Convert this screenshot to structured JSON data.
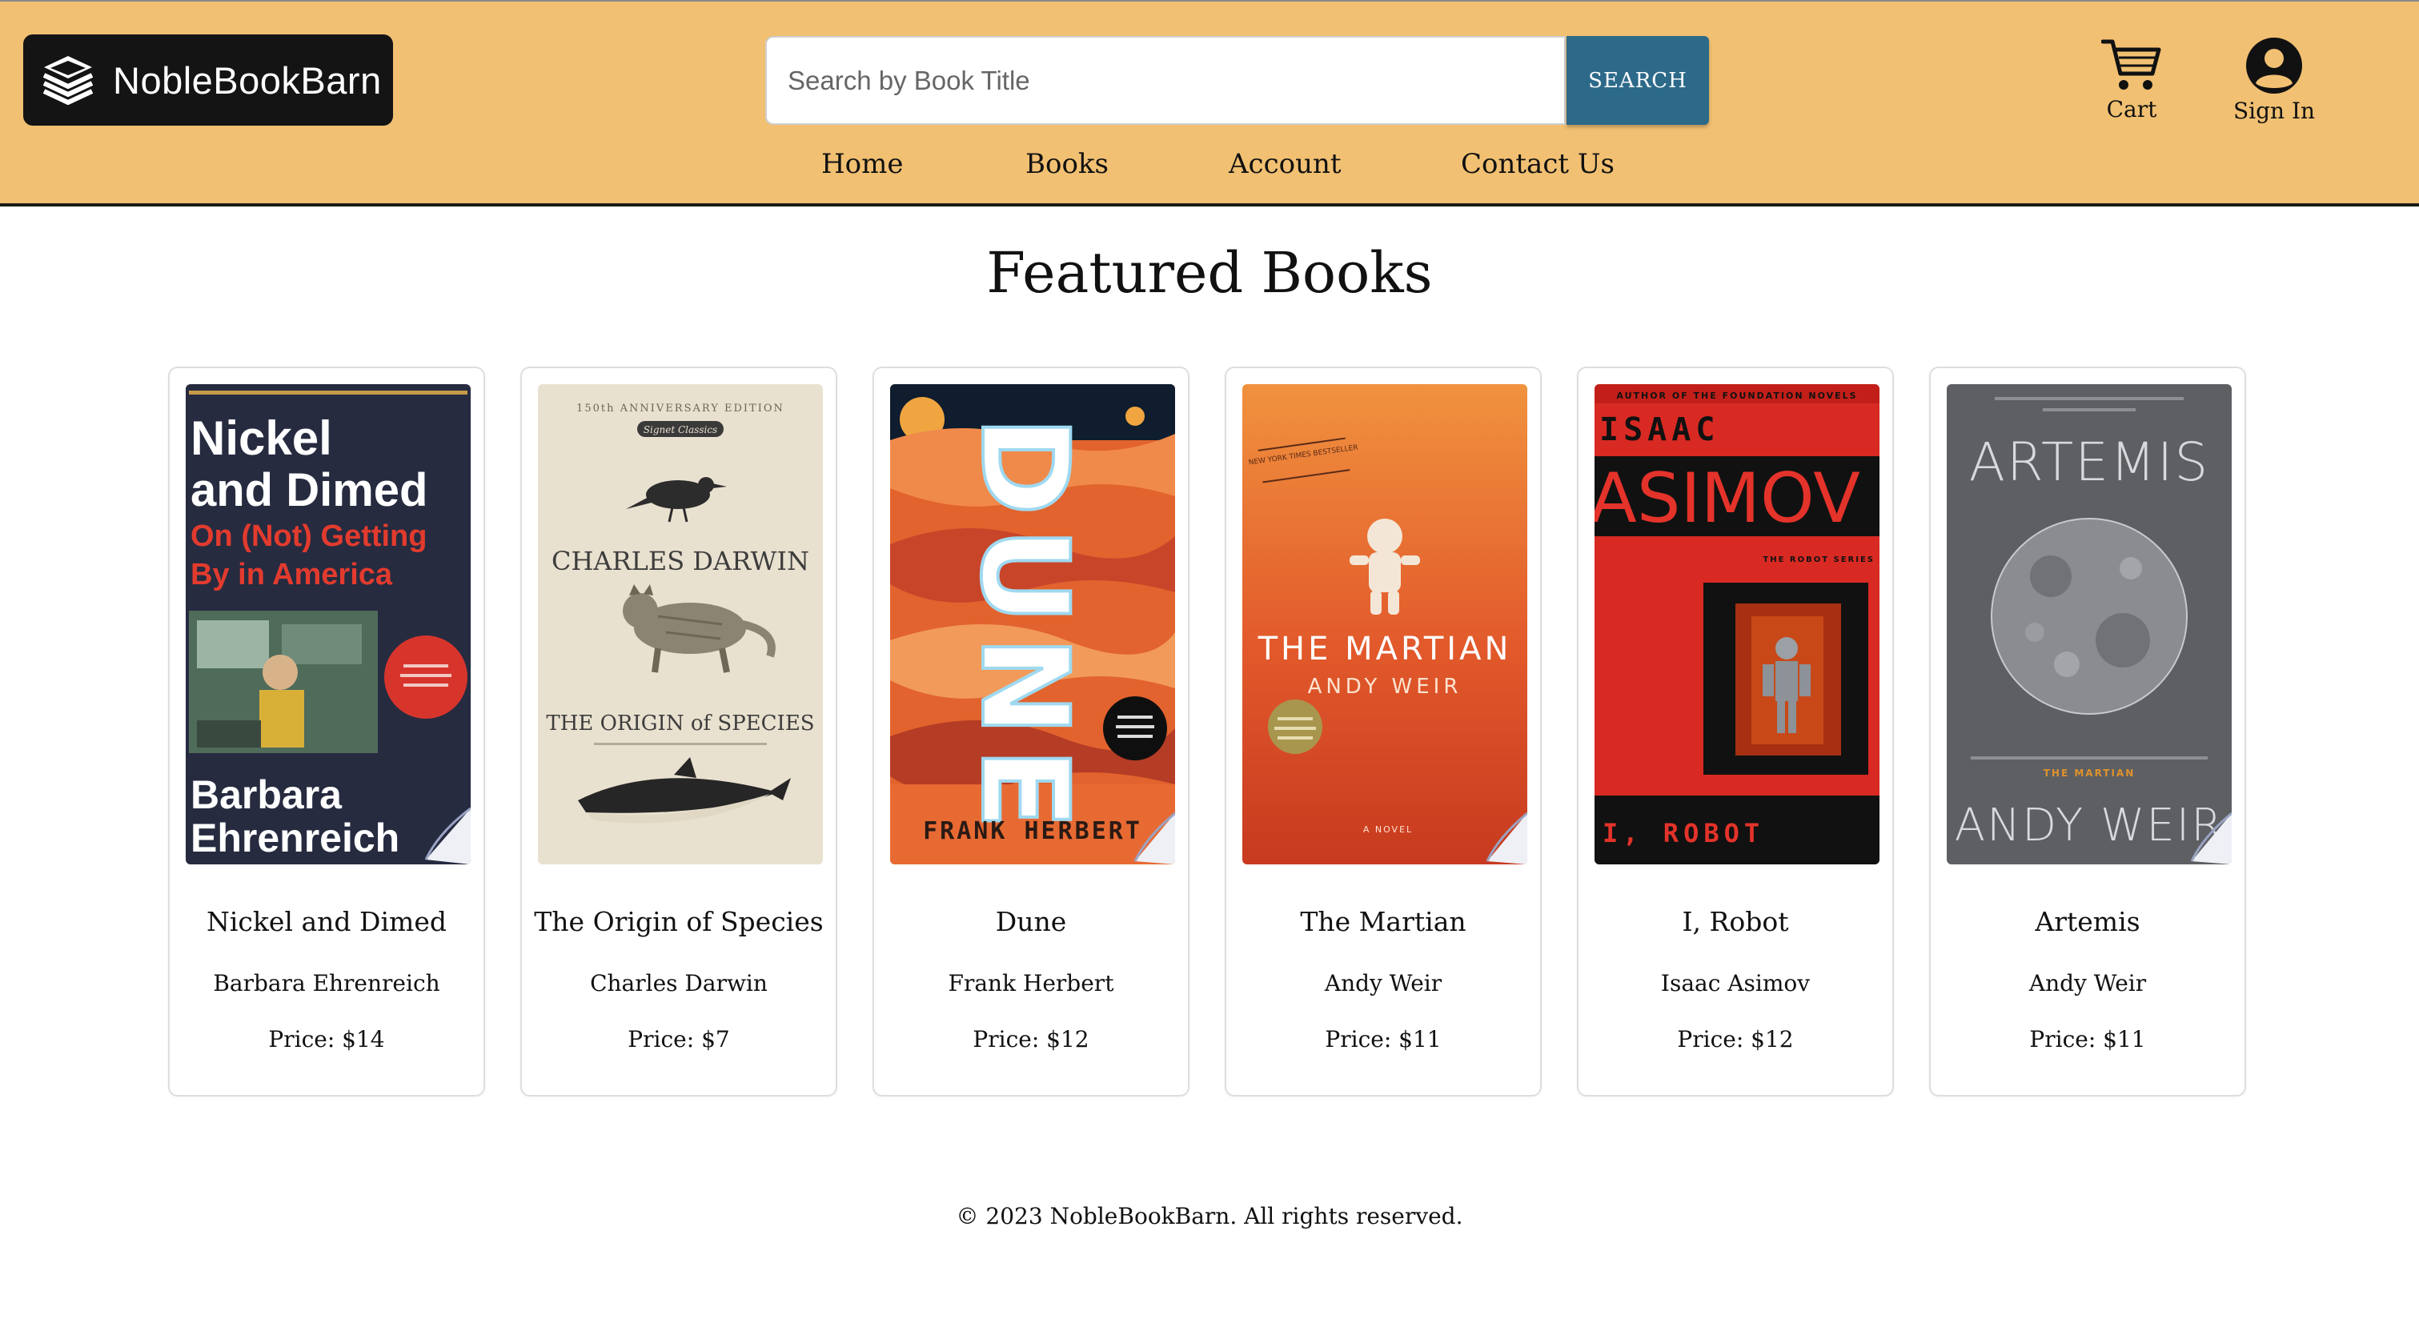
{
  "header": {
    "brand": "NobleBookBarn",
    "search": {
      "placeholder": "Search by Book Title",
      "value": "",
      "button_label": "SEARCH"
    },
    "cart_label": "Cart",
    "signin_label": "Sign In",
    "nav": [
      "Home",
      "Books",
      "Account",
      "Contact Us"
    ],
    "colors": {
      "header_bg": "#f1c072",
      "search_button": "#2d6a8a",
      "logo_bg": "#141414"
    },
    "icons": {
      "logo": "stacked-books-icon",
      "cart": "shopping-cart-icon",
      "signin": "user-circle-icon"
    }
  },
  "main": {
    "title": "Featured Books",
    "books": [
      {
        "title": "Nickel and Dimed",
        "author": "Barbara Ehrenreich",
        "price": "Price: $14",
        "cover": {
          "l1": "Nickel",
          "l2": "and Dimed",
          "l3": "On (Not) Getting",
          "l4": "By in America",
          "l5": "Barbara",
          "l6": "Ehrenreich"
        }
      },
      {
        "title": "The Origin of Species",
        "author": "Charles Darwin",
        "price": "Price: $7",
        "cover": {
          "top": "150th ANNIVERSARY EDITION",
          "label": "Signet Classics",
          "name": "CHARLES DARWIN",
          "sub": "THE ORIGIN of SPECIES"
        }
      },
      {
        "title": "Dune",
        "author": "Frank Herbert",
        "price": "Price: $12",
        "cover": {
          "main": "DUNE",
          "author": "FRANK HERBERT"
        }
      },
      {
        "title": "The Martian",
        "author": "Andy Weir",
        "price": "Price: $11",
        "cover": {
          "badge": "NEW YORK TIMES BESTSELLER",
          "main": "THE MARTIAN",
          "author": "ANDY WEIR",
          "bottom": "A NOVEL"
        }
      },
      {
        "title": "I, Robot",
        "author": "Isaac Asimov",
        "price": "Price: $12",
        "cover": {
          "top": "AUTHOR OF THE FOUNDATION NOVELS",
          "l1": "ISAAC",
          "l2": "ASIMOV",
          "series": "THE ROBOT SERIES",
          "bottom": "I, ROBOT"
        }
      },
      {
        "title": "Artemis",
        "author": "Andy Weir",
        "price": "Price: $11",
        "cover": {
          "main": "ARTEMIS",
          "sub": "THE MARTIAN",
          "author": "ANDY WEIR"
        }
      }
    ]
  },
  "footer": {
    "text": "© 2023 NobleBookBarn. All rights reserved."
  }
}
